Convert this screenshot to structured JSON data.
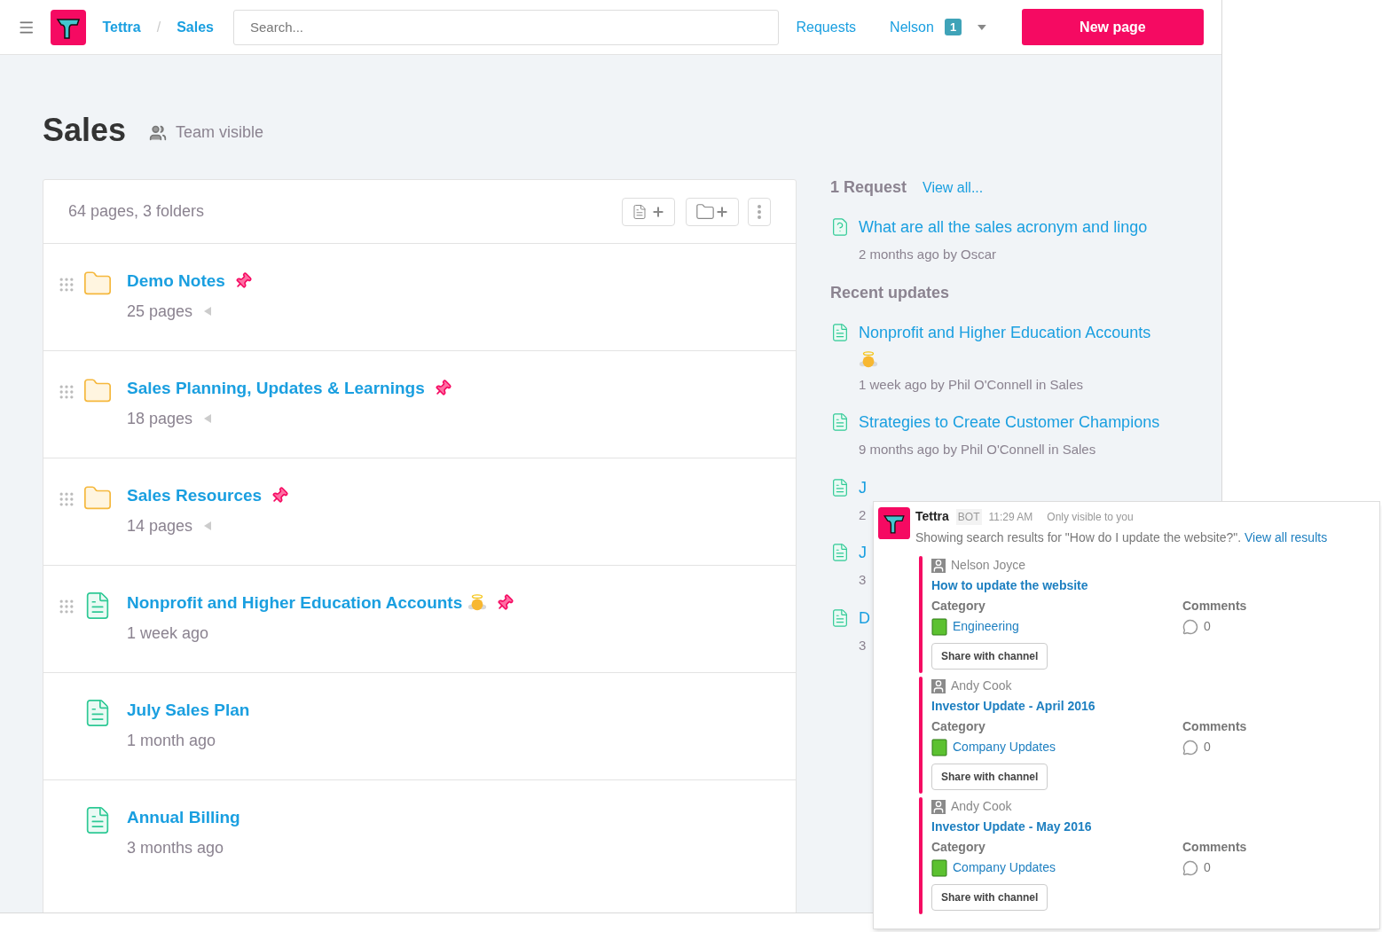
{
  "header": {
    "separator": "/",
    "breadcrumbs": [
      {
        "label": "Tettra"
      },
      {
        "label": "Sales"
      }
    ],
    "search": {
      "placeholder": "Search..."
    },
    "links": [
      "Requests"
    ],
    "user": {
      "name": "Nelson",
      "badge": "1"
    },
    "new_button": "New page"
  },
  "page": {
    "title": "Sales",
    "visibility": "Team visible"
  },
  "list": {
    "summary": "64 pages, 3 folders",
    "items": [
      {
        "kind": "folder",
        "title": "Demo Notes",
        "meta": "25 pages",
        "pinned": true,
        "draggable": true,
        "angel": false
      },
      {
        "kind": "folder",
        "title": "Sales Planning, Updates & Learnings",
        "meta": "18 pages",
        "pinned": true,
        "draggable": true,
        "angel": false
      },
      {
        "kind": "folder",
        "title": "Sales Resources",
        "meta": "14 pages",
        "pinned": true,
        "draggable": true,
        "angel": false
      },
      {
        "kind": "page",
        "title": "Nonprofit and Higher Education Accounts",
        "meta": "1 week ago",
        "pinned": true,
        "draggable": true,
        "angel": true
      },
      {
        "kind": "page",
        "title": "July Sales Plan",
        "meta": "1 month ago",
        "pinned": false,
        "draggable": false,
        "angel": false
      },
      {
        "kind": "page",
        "title": "Annual Billing",
        "meta": "3 months ago",
        "pinned": false,
        "draggable": false,
        "angel": false
      }
    ]
  },
  "sidebar": {
    "requests": {
      "heading": "1 Request",
      "link": "View all...",
      "items": [
        {
          "title": "What are all the sales acronym and lingo",
          "meta": "2 months ago by Oscar"
        }
      ]
    },
    "updates": {
      "heading": "Recent updates",
      "items": [
        {
          "title": "Nonprofit and Higher Education Accounts",
          "angel": true,
          "meta": "1 week ago by Phil O'Connell in Sales"
        },
        {
          "title": "Strategies to Create Customer Champions",
          "angel": false,
          "meta": "9 months ago by Phil O'Connell in Sales"
        },
        {
          "title": "J",
          "angel": false,
          "meta": "2"
        },
        {
          "title": "J",
          "angel": false,
          "meta": "3"
        },
        {
          "title": "D",
          "angel": false,
          "meta": "3"
        }
      ]
    }
  },
  "bot_message": {
    "sender": "Tettra",
    "tag": "BOT",
    "time": "11:29 AM",
    "note": "Only visible to you",
    "text": "Showing search results for \"How do I update the website?\".",
    "link": "View all results",
    "results": [
      {
        "author": "Nelson Joyce",
        "title": "How to update the website",
        "category_label": "Category",
        "category": "Engineering",
        "comments_label": "Comments",
        "comments": "0",
        "button": "Share with channel"
      },
      {
        "author": "Andy Cook",
        "title": "Investor Update - April 2016",
        "category_label": "Category",
        "category": "Company Updates",
        "comments_label": "Comments",
        "comments": "0",
        "button": "Share with channel"
      },
      {
        "author": "Andy Cook",
        "title": "Investor Update - May 2016",
        "category_label": "Category",
        "category": "Company Updates",
        "comments_label": "Comments",
        "comments": "0",
        "button": "Share with channel"
      }
    ]
  }
}
